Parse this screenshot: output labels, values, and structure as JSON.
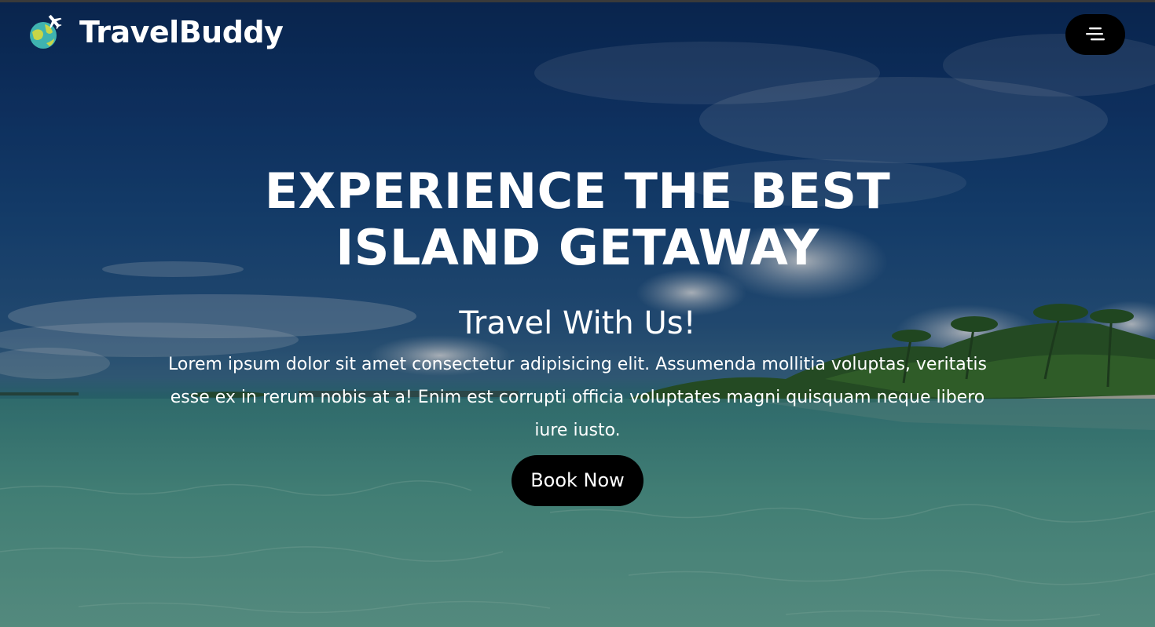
{
  "header": {
    "brand": "TravelBuddy",
    "logo_icon": "globe-plane-icon",
    "menu_icon": "hamburger-menu-icon"
  },
  "hero": {
    "title": "EXPERIENCE THE BEST ISLAND GETAWAY",
    "subtitle": "Travel With Us!",
    "description": "Lorem ipsum dolor sit amet consectetur adipisicing elit. Assumenda mollitia voluptas, veritatis esse ex in rerum nobis at a! Enim est corrupti officia voluptates magni quisquam neque libero iure iusto.",
    "cta_label": "Book Now",
    "background": "tropical-beach-photo"
  },
  "colors": {
    "text": "#ffffff",
    "button_bg": "#000000",
    "sky": "#123d78",
    "water": "#4b9c8f"
  }
}
